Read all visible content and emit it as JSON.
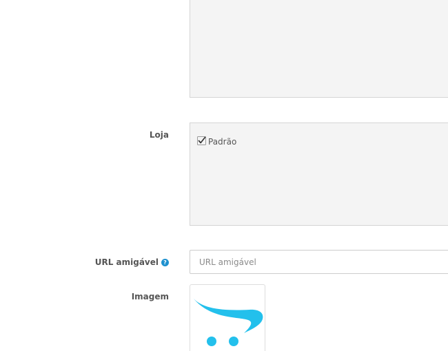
{
  "description_box": {
    "value": ""
  },
  "store": {
    "label": "Loja",
    "options": [
      {
        "label": "Padrão",
        "checked": true
      }
    ]
  },
  "seo_url": {
    "label": "URL amigável",
    "placeholder": "URL amigável",
    "value": "",
    "help_icon": "question-circle-icon"
  },
  "image": {
    "label": "Imagem",
    "thumbnail_icon": "opencart-cart-logo",
    "accent_color": "#23c0ec"
  }
}
